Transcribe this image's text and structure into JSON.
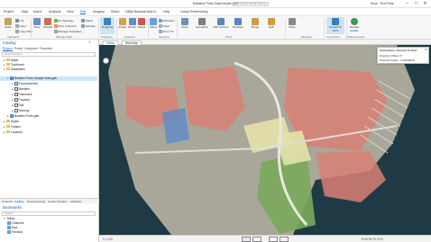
{
  "window": {
    "title": "Maritime Ports Data Model.aprx",
    "search_placeholder": "Command Search (Alt+Q)",
    "user": "Rock - Esri Ports",
    "controls": [
      "–",
      "□",
      "✕"
    ]
  },
  "menu": {
    "tabs": [
      "Project",
      "Map",
      "Insert",
      "Analysis",
      "View",
      "Edit",
      "Imagery",
      "Share",
      "Utility Network Add-In",
      "Help",
      "Linear Referencing"
    ],
    "active_index": 5
  },
  "ribbon": {
    "clipboard": [
      "Paste",
      "Cut",
      "Copy",
      "Copy Path"
    ],
    "manage_edits": [
      "Save",
      "Discard",
      "No Topology",
      "Error Inspector",
      "Manage Templates",
      "Status",
      "Settings"
    ],
    "snapping": "Snapping",
    "features": [
      "Create",
      "Modify",
      "Delete"
    ],
    "selection": [
      "Select",
      "Attributes",
      "Clear",
      "Zoom To"
    ],
    "tools": [
      "Move",
      "Annotation",
      "Edit Vertices",
      "Reshape",
      "Merge",
      "Split"
    ],
    "elevation": "Mode",
    "corrections": "Ground To Grid",
    "data_reviewer": "Manage Quality",
    "group_labels": [
      "Clipboard",
      "Manage Edits",
      "Snapping",
      "Features",
      "Selection",
      "Tools",
      "Elevation",
      "Corrections",
      "Data Reviewer"
    ]
  },
  "catalog": {
    "title": "Catalog",
    "tabs": [
      "Project",
      "Portal",
      "Computer",
      "Favorites"
    ],
    "search_placeholder": "Search Project",
    "tree": [
      {
        "label": "Maps",
        "level": 0,
        "kind": "folder",
        "expanded": false
      },
      {
        "label": "Toolboxes",
        "level": 0,
        "kind": "folder",
        "expanded": false
      },
      {
        "label": "Databases",
        "level": 0,
        "kind": "folder",
        "expanded": true
      },
      {
        "label": "Maritime Ports Sample Data.gdb",
        "level": 1,
        "kind": "gdb",
        "expanded": true,
        "selected": true
      },
      {
        "label": "Environmental",
        "level": 2,
        "kind": "dataset"
      },
      {
        "label": "Maritime",
        "level": 2,
        "kind": "dataset"
      },
      {
        "label": "Pavement",
        "level": 2,
        "kind": "dataset"
      },
      {
        "label": "Property",
        "level": 2,
        "kind": "dataset"
      },
      {
        "label": "Rail",
        "level": 2,
        "kind": "dataset"
      },
      {
        "label": "Security",
        "level": 2,
        "kind": "dataset"
      },
      {
        "label": "Maritime Ports.gdb",
        "level": 1,
        "kind": "gdb",
        "expanded": false
      },
      {
        "label": "Styles",
        "level": 0,
        "kind": "folder",
        "expanded": false
      },
      {
        "label": "Folders",
        "level": 0,
        "kind": "folder",
        "expanded": false
      },
      {
        "label": "Locators",
        "level": 0,
        "kind": "folder",
        "expanded": false
      }
    ]
  },
  "pane_tabs": [
    "Contents",
    "Catalog",
    "Geoprocessing",
    "Create Features",
    "Attributes"
  ],
  "bookmarks": {
    "title": "Bookmarks",
    "search_placeholder": "Search",
    "groups": [
      "Yellow",
      "Channels",
      "Yard",
      "Terminal"
    ]
  },
  "map": {
    "tabs": [
      "Yellow",
      "Web Map"
    ],
    "popup": {
      "title": "Corrections: Ground To Grid",
      "lines": [
        "Direction Offset: 0°",
        "Distance Factor: 1.00000000"
      ]
    },
    "colors": {
      "water": "#203a45",
      "land": "#a8a79a",
      "red_parcel": "#d98074",
      "green_parcel": "#7aaa5b",
      "yellow_parcel": "#e4e2a8"
    }
  },
  "status": {
    "scale": "1:7,143",
    "coords": "75.40°W 29.74°N"
  }
}
